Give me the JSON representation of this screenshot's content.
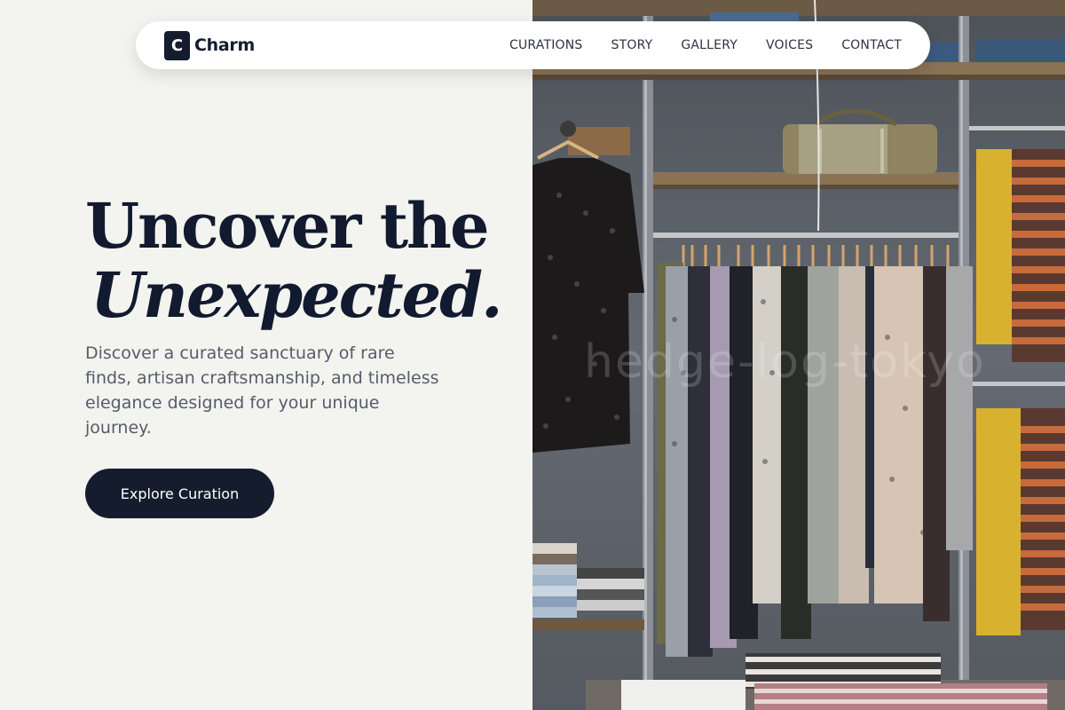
{
  "brand": {
    "mark": "C",
    "name": "Charm"
  },
  "nav": {
    "links": [
      {
        "label": "CURATIONS"
      },
      {
        "label": "STORY"
      },
      {
        "label": "GALLERY"
      },
      {
        "label": "VOICES"
      },
      {
        "label": "CONTACT"
      }
    ]
  },
  "hero": {
    "title_line1": "Uncover the",
    "title_line2": "Unexpected.",
    "description": "Discover a curated sanctuary of rare finds, artisan craftsmanship, and timeless elegance designed for your unique journey.",
    "cta_label": "Explore Curation"
  },
  "photo": {
    "watermark": "hedge-log-tokyo",
    "subject": "clothing-rack-photo"
  },
  "colors": {
    "background": "#f3f3ef",
    "primary": "#141c2e",
    "text_muted": "#555c6b"
  }
}
